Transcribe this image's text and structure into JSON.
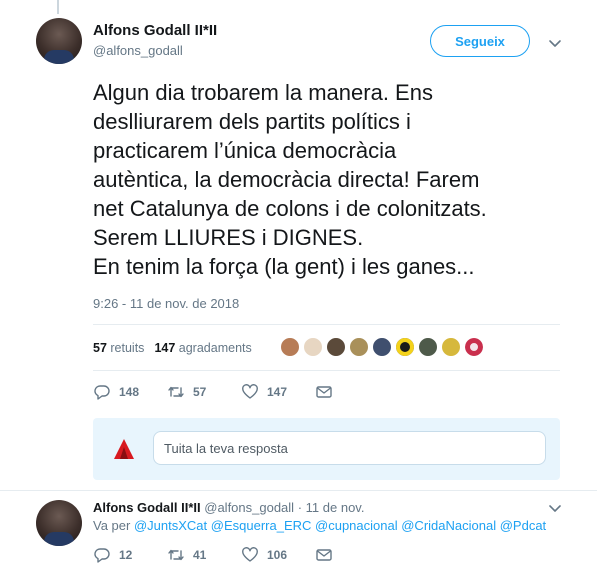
{
  "tweet": {
    "author_name": "Alfons Godall II*II",
    "author_handle": "@alfons_godall",
    "follow_label": "Segueix",
    "text": "Algun dia trobarem la manera. Ens\ndeslliurarem dels partits polítics i\npracticarem l’única democràcia\nautèntica, la democràcia directa! Farem\nnet Catalunya de colons i de colonitzats.\nSerem LLIURES i DIGNES.\nEn tenim la força (la gent) i les ganes...",
    "timestamp": "9:26 - 11 de nov. de 2018",
    "stats": {
      "retweets_count": "57",
      "retweets_label": "retuits",
      "likes_count": "147",
      "likes_label": "agradaments"
    },
    "actions": {
      "replies": "148",
      "retweets": "57",
      "likes": "147"
    }
  },
  "reply_box": {
    "placeholder": "Tuita la teva resposta"
  },
  "reply": {
    "author_name": "Alfons Godall II*II",
    "author_handle": "@alfons_godall",
    "separator": "·",
    "date": "11 de nov.",
    "replying_prefix": "Va per",
    "mentions": [
      "@JuntsXCat",
      "@Esquerra_ERC",
      "@cupnacional",
      "@CridaNacional",
      "@Pdcat"
    ],
    "actions": {
      "replies": "12",
      "retweets": "41",
      "likes": "106"
    }
  },
  "colors": {
    "accent": "#1da1f2",
    "text": "#14171a",
    "muted": "#657786",
    "reply_box_bg": "#e8f5fd"
  },
  "liker_icons": [
    "liker-avatar-1",
    "liker-avatar-2",
    "liker-avatar-3",
    "liker-avatar-4",
    "liker-avatar-5",
    "liker-avatar-6",
    "liker-avatar-7",
    "liker-avatar-8",
    "liker-avatar-9"
  ]
}
